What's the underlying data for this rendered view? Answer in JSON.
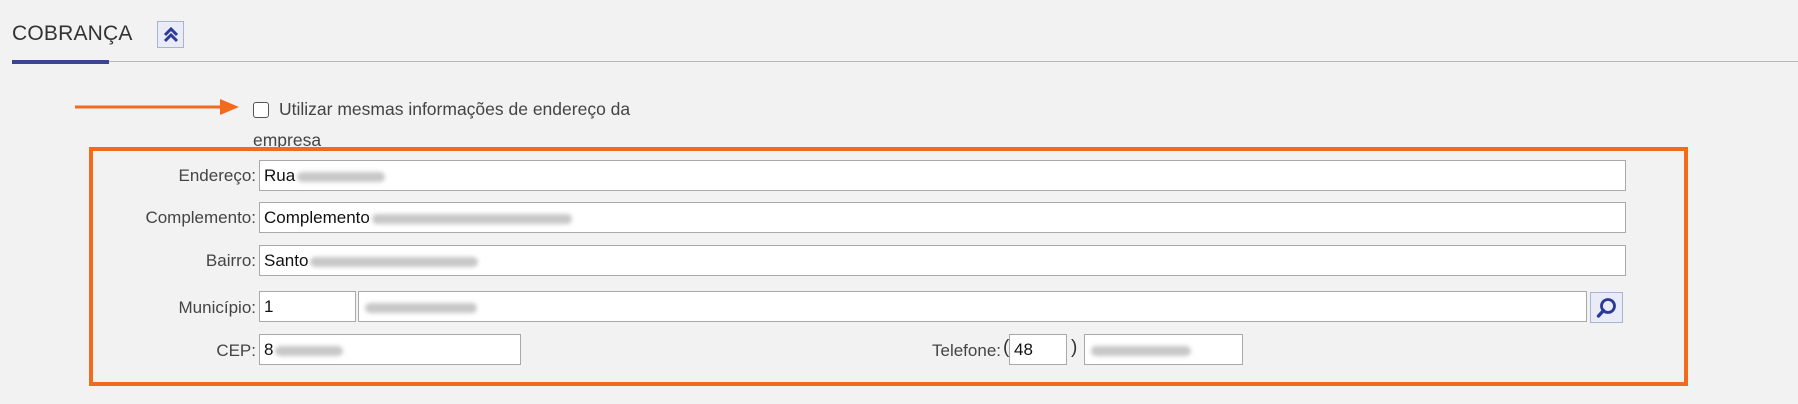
{
  "section": {
    "title": "COBRANÇA"
  },
  "same_address": {
    "line1": "Utilizar mesmas informações de endereço da",
    "line2": "empresa",
    "checked": false
  },
  "fields": {
    "endereco": {
      "label": "Endereço:",
      "value": "Rua"
    },
    "complemento": {
      "label": "Complemento:",
      "value": "Complemento"
    },
    "bairro": {
      "label": "Bairro:",
      "value": "Santo"
    },
    "municipio": {
      "label": "Município:",
      "code": "1"
    },
    "cep": {
      "label": "CEP:",
      "value": "8"
    },
    "telefone": {
      "label": "Telefone:",
      "open_paren": "(",
      "ddd": "48",
      "close_paren": ")"
    }
  },
  "icons": {
    "collapse": "double-chevron-up-icon",
    "search": "magnifier-icon",
    "arrow": "arrow-right-icon"
  },
  "colors": {
    "highlight": "#f36a1d",
    "accent": "#3b4590",
    "icon": "#2b3a9a"
  }
}
